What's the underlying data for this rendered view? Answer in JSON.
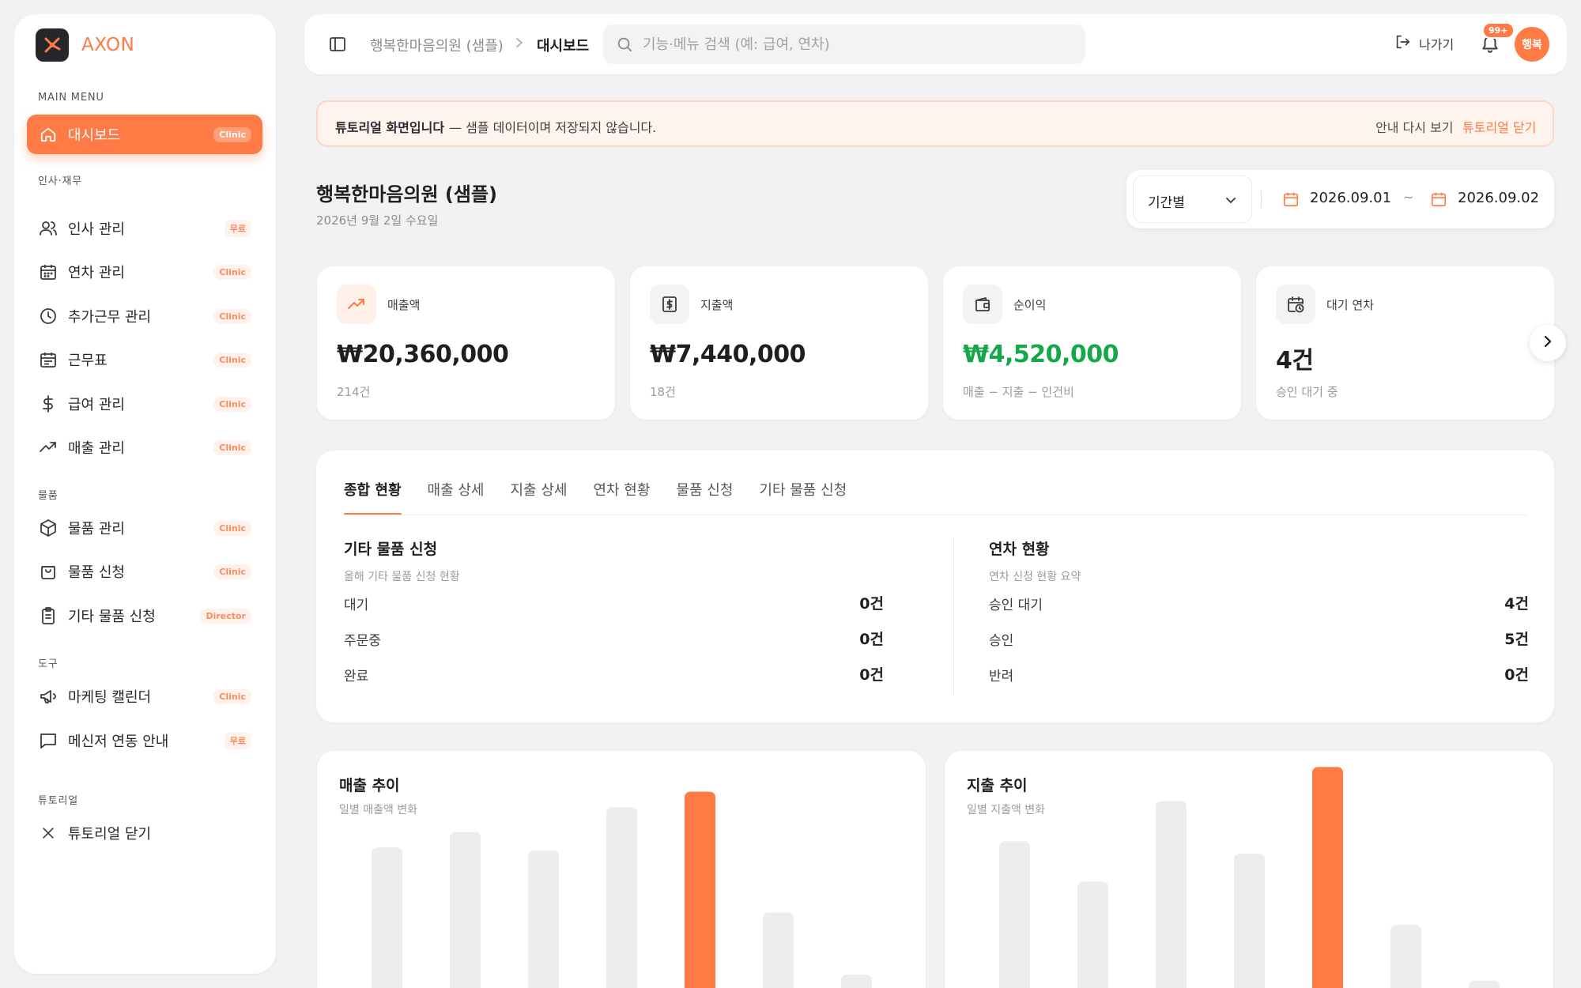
{
  "brand": {
    "name": "AXON"
  },
  "sidebar": {
    "main_menu_label": "MAIN MENU",
    "dashboard": {
      "label": "대시보드",
      "badge": "Clinic"
    },
    "sections": [
      {
        "label": "인사·재무",
        "items": [
          {
            "label": "인사 관리",
            "badge": "무료",
            "icon": "users-icon"
          },
          {
            "label": "연차 관리",
            "badge": "Clinic",
            "icon": "calendar-icon"
          },
          {
            "label": "추가근무 관리",
            "badge": "Clinic",
            "icon": "clock-icon"
          },
          {
            "label": "근무표",
            "badge": "Clinic",
            "icon": "schedule-icon"
          },
          {
            "label": "급여 관리",
            "badge": "Clinic",
            "icon": "dollar-icon"
          },
          {
            "label": "매출 관리",
            "badge": "Clinic",
            "icon": "trend-icon"
          }
        ]
      },
      {
        "label": "물품",
        "items": [
          {
            "label": "물품 관리",
            "badge": "Clinic",
            "icon": "box-icon"
          },
          {
            "label": "물품 신청",
            "badge": "Clinic",
            "icon": "bag-icon"
          },
          {
            "label": "기타 물품 신청",
            "badge": "Director",
            "icon": "clipboard-icon"
          }
        ]
      },
      {
        "label": "도구",
        "items": [
          {
            "label": "마케팅 캘린더",
            "badge": "Clinic",
            "icon": "megaphone-icon"
          },
          {
            "label": "메신저 연동 안내",
            "badge": "무료",
            "icon": "chat-icon"
          }
        ]
      },
      {
        "label": "튜토리얼",
        "items": [
          {
            "label": "튜토리얼 닫기",
            "badge": "",
            "icon": "close-icon"
          }
        ]
      }
    ]
  },
  "header": {
    "breadcrumb": [
      "행복한마음의원 (샘플)",
      "대시보드"
    ],
    "search_placeholder": "기능·메뉴 검색 (예: 급여, 연차)",
    "exit_label": "나가기",
    "notification_count": "99+",
    "avatar_text": "행복"
  },
  "banner": {
    "strong": "튜토리얼 화면입니다",
    "text": "— 샘플 데이터이며 저장되지 않습니다.",
    "guide_again": "안내 다시 보기",
    "close": "튜토리얼 닫기"
  },
  "page": {
    "title": "행복한마음의원 (샘플)",
    "date": "2026년 9월 2일 수요일",
    "period_select": "기간별",
    "date_from": "2026.09.01",
    "date_sep": "~",
    "date_to": "2026.09.02"
  },
  "stats": [
    {
      "label": "매출액",
      "value": "₩20,360,000",
      "sub": "214건",
      "icon": "trend-up-icon",
      "accent": true
    },
    {
      "label": "지출액",
      "value": "₩7,440,000",
      "sub": "18건",
      "icon": "receipt-icon",
      "accent": false
    },
    {
      "label": "순이익",
      "value": "₩4,520,000",
      "sub": "매출 − 지출 − 인건비",
      "icon": "wallet-icon",
      "accent": false,
      "value_color": "#14a84a"
    },
    {
      "label": "대기 연차",
      "value": "4건",
      "sub": "승인 대기 중",
      "icon": "calendar-clock-icon",
      "accent": false
    }
  ],
  "tabs": [
    "종합 현황",
    "매출 상세",
    "지출 상세",
    "연차 현황",
    "물품 신청",
    "기타 물품 신청"
  ],
  "overview": {
    "left": {
      "title": "기타 물품 신청",
      "sub": "올해 기타 물품 신청 현황",
      "rows": [
        {
          "k": "대기",
          "v": "0건"
        },
        {
          "k": "주문중",
          "v": "0건"
        },
        {
          "k": "완료",
          "v": "0건"
        }
      ]
    },
    "right": {
      "title": "연차 현황",
      "sub": "연차 신청 현황 요약",
      "rows": [
        {
          "k": "승인 대기",
          "v": "4건"
        },
        {
          "k": "승인",
          "v": "5건"
        },
        {
          "k": "반려",
          "v": "0건"
        }
      ]
    }
  },
  "colors": {
    "accent": "#ff7a45",
    "positive": "#14a84a",
    "bar_muted": "#ededee"
  },
  "chart_data": [
    {
      "type": "bar",
      "title": "매출 추이",
      "subtitle": "일별 매출액 변화",
      "values": [
        0.53,
        0.58,
        0.52,
        0.66,
        0.71,
        0.32,
        0.12
      ],
      "highlight_index": 4
    },
    {
      "type": "bar",
      "title": "지출 추이",
      "subtitle": "일별 지출액 변화",
      "values": [
        0.55,
        0.42,
        0.68,
        0.51,
        0.79,
        0.28,
        0.1
      ],
      "highlight_index": 4
    }
  ]
}
